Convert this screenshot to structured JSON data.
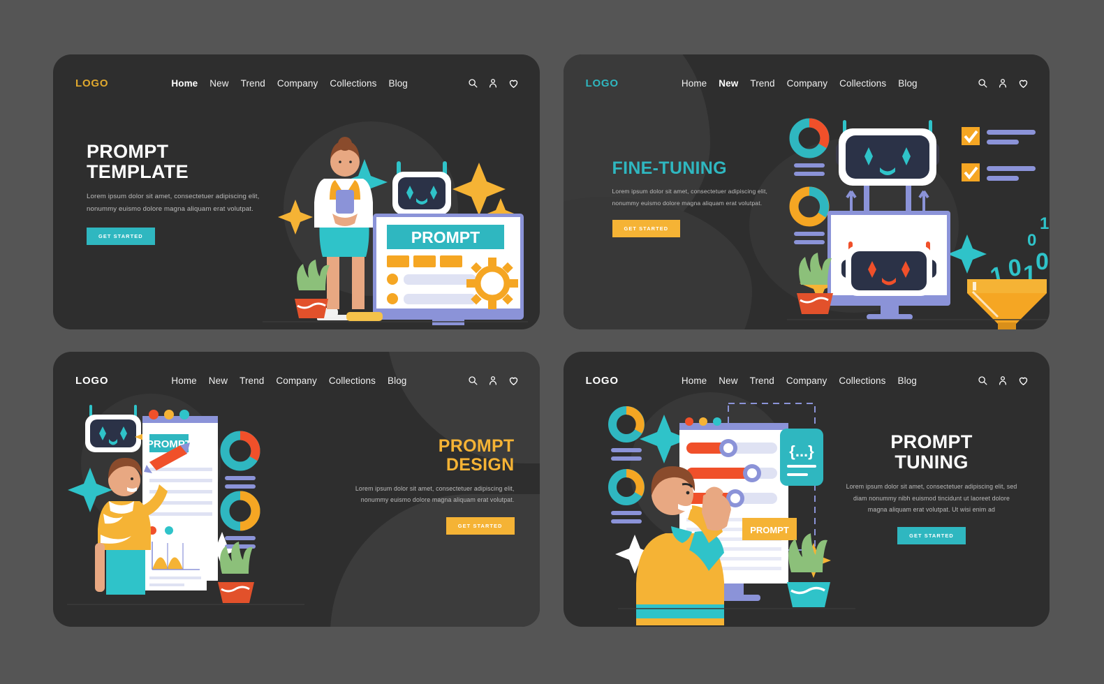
{
  "theme": {
    "page_background": "#555555",
    "panel_background": "#2e2e2e",
    "teal": "#2fb7c0",
    "orange": "#f5b335",
    "white": "#ffffff",
    "body_text": "#bdbdbd",
    "red": "#f0502a",
    "periwinkle": "#8b93d8"
  },
  "nav": {
    "links": [
      "Home",
      "New",
      "Trend",
      "Company",
      "Collections",
      "Blog"
    ],
    "icons": [
      "search-icon",
      "user-icon",
      "heart-icon"
    ]
  },
  "panels": [
    {
      "id": "panel1",
      "logo": "LOGO",
      "logo_color": "#e0a92e",
      "active_link": "Home",
      "title_line1": "PROMPT",
      "title_line2": "TEMPLATE",
      "body": "Lorem ipsum dolor sit amet, consectetuer adipiscing elit, nonummy euismo dolore magna aliquam erat volutpat.",
      "cta": "GET STARTED",
      "cta_style": "teal",
      "art": {
        "screen_label": "PROMPT"
      }
    },
    {
      "id": "panel2",
      "logo": "LOGO",
      "logo_color": "#2fb7c0",
      "active_link": "New",
      "title_line1": "FINE-TUNING",
      "title_line2": "",
      "body": "Lorem ipsum dolor sit amet, consectetuer adipiscing elit, nonummy euismo dolore magna aliquam erat volutpat.",
      "cta": "GET STARTED",
      "cta_style": "orange",
      "art": {
        "binary_digits": [
          "1",
          "0",
          "0",
          "1",
          "1",
          "0"
        ]
      }
    },
    {
      "id": "panel3",
      "logo": "LOGO",
      "logo_color": "#ffffff",
      "active_link": "",
      "title_line1": "PROMPT",
      "title_line2": "DESIGN",
      "body": "Lorem ipsum dolor sit amet, consectetuer adipiscing elit, nonummy euismo dolore magna aliquam erat volutpat.",
      "cta": "GET STARTED",
      "cta_style": "orange",
      "art": {
        "screen_label": "PROMPT"
      }
    },
    {
      "id": "panel4",
      "logo": "LOGO",
      "logo_color": "#ffffff",
      "active_link": "",
      "title_line1": "PROMPT",
      "title_line2": "TUNING",
      "body": "Lorem ipsum dolor sit amet, consectetuer adipiscing elit, sed diam nonummy nibh euismod tincidunt ut laoreet dolore magna aliquam erat volutpat. Ut wisi enim ad",
      "cta": "GET STARTED",
      "cta_style": "teal",
      "art": {
        "screen_label": "PROMPT",
        "code_glyph": "{...}"
      }
    }
  ]
}
